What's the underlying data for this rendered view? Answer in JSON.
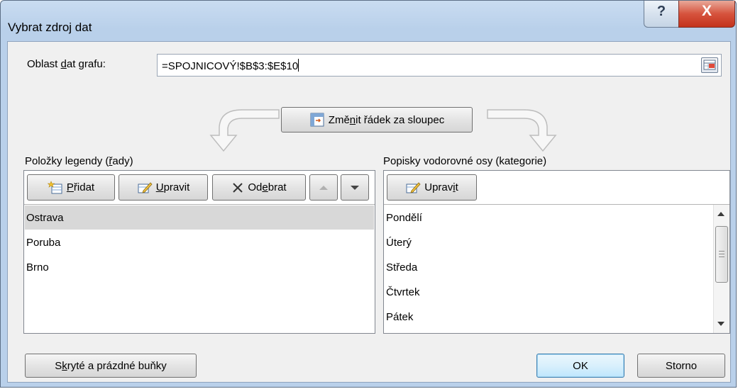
{
  "window": {
    "title": "Vybrat zdroj dat",
    "help_label": "?",
    "close_label": "X"
  },
  "range": {
    "label_pre": "Oblast ",
    "label_key": "d",
    "label_post": "at grafu:",
    "value": "=SPOJNICOVÝ!$B$3:$E$10"
  },
  "switch_button": {
    "pre": "Změ",
    "key": "n",
    "post": "it řádek za sloupec"
  },
  "legend": {
    "label_pre": "Položky legendy (",
    "label_key": "ř",
    "label_post": "ady)",
    "add": {
      "key": "P",
      "post": "řidat"
    },
    "edit": {
      "key": "U",
      "post": "pravit"
    },
    "remove": {
      "pre": "Od",
      "key": "e",
      "post": "brat"
    },
    "items": [
      "Ostrava",
      "Poruba",
      "Brno"
    ],
    "selected_index": 0
  },
  "axis": {
    "label_pre": "Popisky vodorovné osy (kate",
    "label_key": "g",
    "label_post": "orie)",
    "edit": {
      "pre": "Uprav",
      "key": "i",
      "post": "t"
    },
    "items": [
      "Pondělí",
      "Úterý",
      "Středa",
      "Čtvrtek",
      "Pátek"
    ]
  },
  "footer": {
    "hidden_cells": {
      "pre": "S",
      "key": "k",
      "post": "ryté a prázdné buňky"
    },
    "ok_label": "OK",
    "cancel_label": "Storno"
  },
  "colors": {
    "title_bar": "#b9d0ea",
    "dialog_bg": "#f0f0f0",
    "close_red": "#c4331c",
    "selection": "#d8d8d8"
  },
  "icons": [
    "help-icon",
    "close-icon",
    "range-collapse-icon",
    "switch-row-column-icon",
    "add-series-icon",
    "edit-icon",
    "remove-x-icon",
    "move-up-icon",
    "move-down-icon"
  ]
}
